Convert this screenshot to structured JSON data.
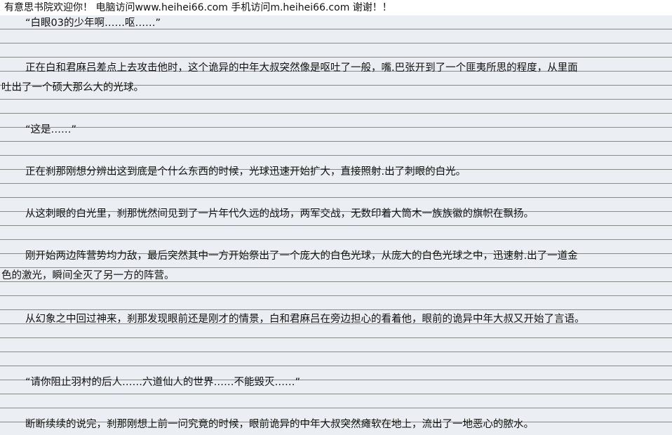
{
  "banner": {
    "text": "有意思书院欢迎你！ 电脑访问www.heihei66.com   手机访问m.heihei66.com  谢谢！！"
  },
  "paragraphs": [
    {
      "lines": [
        "“白眼03的少年啊……呕……”"
      ]
    },
    {
      "lines": [
        "正在白和君麻吕差点上去攻击他时，这个诡异的中年大叔突然像是呕吐了一般，嘴.巴张开到了一个匪夷所思的程度，从里面",
        "吐出了一个硕大那么大的光球。"
      ]
    },
    {
      "lines": [
        "“这是……”"
      ]
    },
    {
      "lines": [
        "正在刹那刚想分辨出这到底是个什么东西的时候，光球迅速开始扩大，直接照射.出了刺眼的白光。"
      ]
    },
    {
      "lines": [
        "从这刺眼的白光里，刹那恍然间见到了一片年代久远的战场，两军交战，无数印着大筒木一族族徽的旗帜在飘扬。"
      ]
    },
    {
      "lines": [
        "刚开始两边阵营势均力敌，最后突然其中一方开始祭出了一个庞大的白色光球，从庞大的白色光球之中，迅速射.出了一道金",
        "色的激光，瞬间全灭了另一方的阵营。"
      ]
    },
    {
      "lines": [
        "从幻象之中回过神来，刹那发现眼前还是刚才的情景，白和君麻吕在旁边担心的看着他，眼前的诡异中年大叔又开始了言语。"
      ]
    },
    {
      "lines": [
        "“请你阻止羽村的后人……六道仙人的世界……不能毁灭……”"
      ]
    },
    {
      "lines": [
        "断断续续的说完，刹那刚想上前一问究竟的时候，眼前诡异的中年大叔突然瘫软在地上，流出了一地恶心的脓水。"
      ]
    }
  ]
}
